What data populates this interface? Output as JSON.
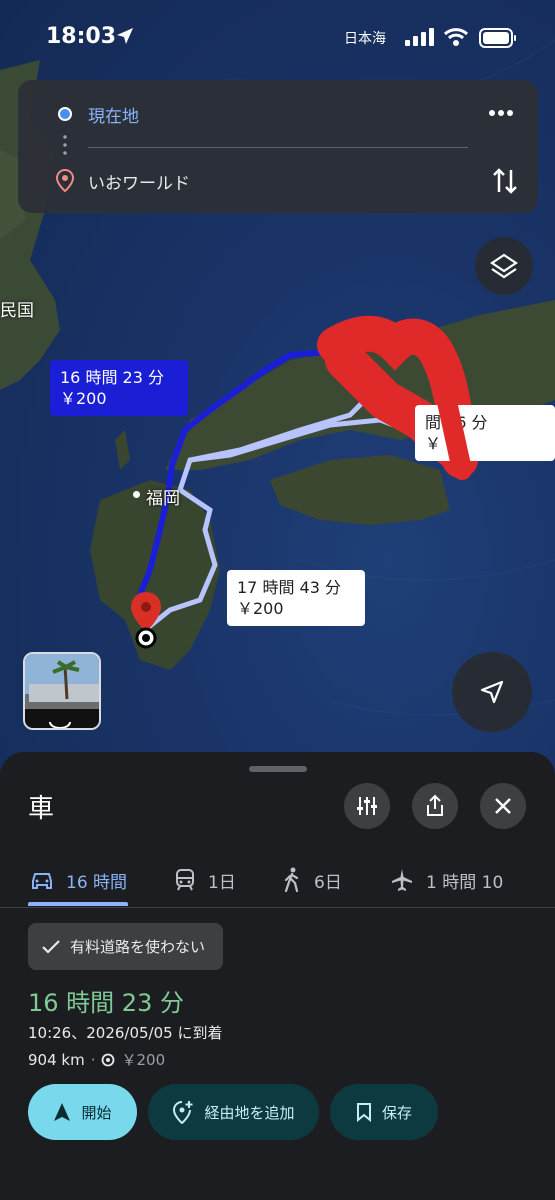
{
  "status_bar": {
    "time": "18:03",
    "carrier": "日本海"
  },
  "route_panel": {
    "origin": "現在地",
    "destination": "いおワールド"
  },
  "map": {
    "place_labels": {
      "fukuoka": "福岡",
      "korea_partial": "民国"
    },
    "routes": [
      {
        "id": "best",
        "duration": "16 時間 23 分",
        "fare": "￥200"
      },
      {
        "id": "alt1",
        "duration": "17 時間 43 分",
        "fare": "￥200"
      },
      {
        "id": "alt2",
        "duration": "間 56 分",
        "fare": "￥  0"
      }
    ]
  },
  "sheet": {
    "title": "車",
    "modes": [
      {
        "id": "car",
        "label": "16 時間",
        "icon": "car-icon",
        "active": true
      },
      {
        "id": "transit",
        "label": "1日",
        "icon": "train-icon",
        "active": false
      },
      {
        "id": "walk",
        "label": "6日",
        "icon": "walk-icon",
        "active": false
      },
      {
        "id": "flight",
        "label": "1 時間 10",
        "icon": "plane-icon",
        "active": false
      }
    ],
    "option_chip": "有料道路を使わない",
    "duration": "16 時間 23 分",
    "arrival": "10:26、2026/05/05 に到着",
    "distance": "904 km",
    "separator": "·",
    "toll": "￥200",
    "actions": {
      "start": "開始",
      "add_stop": "経由地を追加",
      "save": "保存"
    }
  },
  "colors": {
    "route_primary": "#1a1fd6",
    "route_alt": "#b8c4ff",
    "accent": "#8ab4f8",
    "duration_green": "#81c995",
    "start_button": "#78d9ec"
  }
}
